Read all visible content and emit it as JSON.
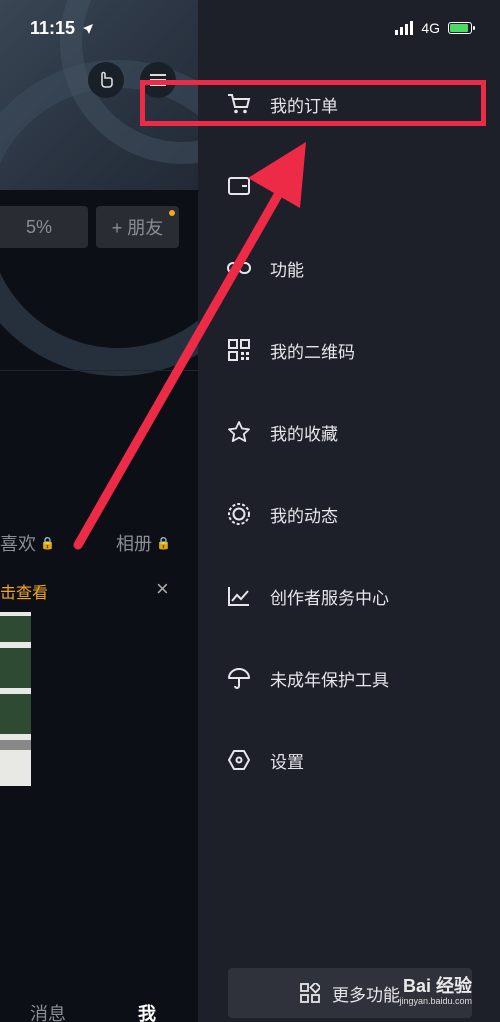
{
  "status": {
    "time": "11:15",
    "network": "4G"
  },
  "profile": {
    "stat_partial": "5%",
    "add_friend_label": "+ 朋友",
    "tab_likes": "喜欢",
    "tab_album": "相册",
    "banner_text": "击查看",
    "banner_close": "×",
    "nav_messages": "消息",
    "nav_me": "我"
  },
  "drawer": {
    "items": [
      {
        "label": "我的订单",
        "icon": "cart-icon"
      },
      {
        "label": "",
        "icon": "wallet-icon"
      },
      {
        "label": "功能",
        "icon": "link-icon"
      },
      {
        "label": "我的二维码",
        "icon": "qr-code-icon"
      },
      {
        "label": "我的收藏",
        "icon": "star-icon"
      },
      {
        "label": "我的动态",
        "icon": "activity-circle-icon"
      },
      {
        "label": "创作者服务中心",
        "icon": "chart-line-icon"
      },
      {
        "label": "未成年保护工具",
        "icon": "umbrella-icon"
      },
      {
        "label": "设置",
        "icon": "settings-hexagon-icon"
      }
    ],
    "more_label": "更多功能"
  },
  "watermark": {
    "main": "Bai 经验",
    "sub": "jingyan.baidu.com"
  },
  "colors": {
    "annotation": "#ee2b47",
    "accent": "#f5a623",
    "drawer_bg": "#1e2029"
  }
}
